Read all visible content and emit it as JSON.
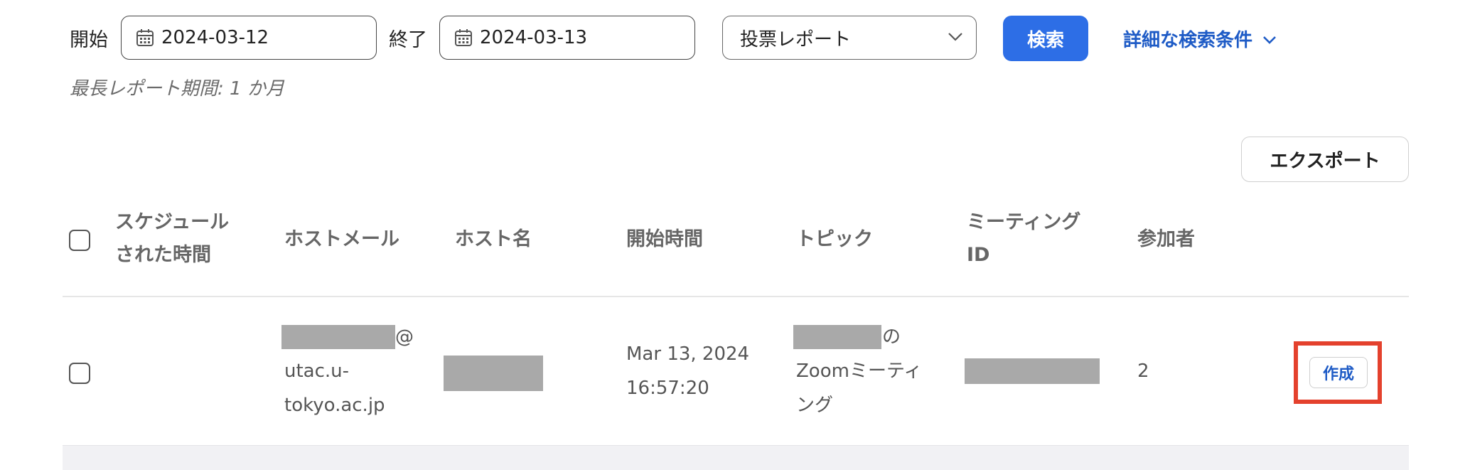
{
  "filters": {
    "start_label": "開始",
    "start_date": "2024-03-12",
    "end_label": "終了",
    "end_date": "2024-03-13",
    "report_type": "投票レポート",
    "search_button": "検索",
    "advanced_search": "詳細な検索条件",
    "max_period_note": "最長レポート期間: 1 か月"
  },
  "toolbar": {
    "export_button": "エクスポート"
  },
  "table": {
    "headers": {
      "scheduled_line1": "スケジュール",
      "scheduled_line2": "された時間",
      "host_email": "ホストメール",
      "host_name": "ホスト名",
      "start_time": "開始時間",
      "topic": "トピック",
      "meeting_id_line1": "ミーティング",
      "meeting_id_line2": "ID",
      "participants": "参加者"
    },
    "rows": [
      {
        "scheduled": "",
        "host_email_at": "@",
        "host_email_line2": "utac.u-",
        "host_email_line3": "tokyo.ac.jp",
        "start_date": "Mar 13, 2024",
        "start_time": "16:57:20",
        "topic_suffix": "の",
        "topic_line2": "Zoomミーティ",
        "topic_line3": "ング",
        "participants": "2",
        "action": "作成"
      }
    ]
  },
  "colors": {
    "primary": "#2d6ee6",
    "link": "#1e5bc6",
    "highlight": "#e4412d",
    "redaction": "#a9a9a9"
  }
}
